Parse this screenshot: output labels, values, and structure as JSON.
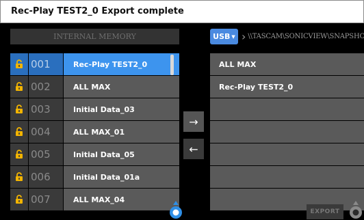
{
  "title": "Rec-Play TEST2_0 Export complete",
  "source_header": "INTERNAL MEMORY",
  "destination": {
    "device": "USB",
    "path": "\\\\TASCAM\\SONICVIEW\\SNAPSHOT\\"
  },
  "left_rows": [
    {
      "num": "001",
      "name": "Rec-Play TEST2_0",
      "selected": true
    },
    {
      "num": "002",
      "name": "ALL MAX",
      "selected": false
    },
    {
      "num": "003",
      "name": "Initial Data_03",
      "selected": false
    },
    {
      "num": "004",
      "name": "ALL MAX_01",
      "selected": false
    },
    {
      "num": "005",
      "name": "Initial Data_05",
      "selected": false
    },
    {
      "num": "006",
      "name": "Initial Data_01a",
      "selected": false
    },
    {
      "num": "007",
      "name": "ALL MAX_04",
      "selected": false
    }
  ],
  "right_rows": [
    "ALL MAX",
    "Rec-Play TEST2_0",
    "",
    "",
    "",
    "",
    ""
  ],
  "arrows": {
    "copy_right": "→",
    "copy_left": "←"
  },
  "export_label": "EXPORT",
  "colors": {
    "accent": "#3d94ee",
    "usb": "#4a8ae0",
    "lock": "#f2b400",
    "knob_left": "#2f8fe6",
    "knob_right": "#8a8a8a"
  }
}
